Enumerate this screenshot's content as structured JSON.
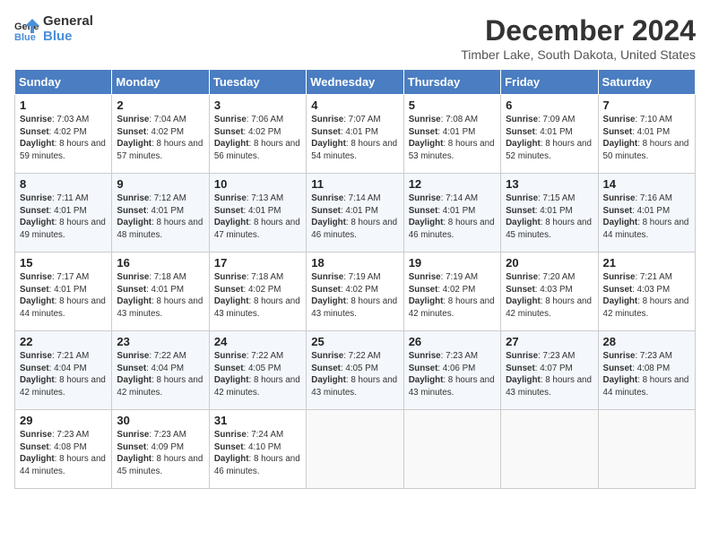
{
  "header": {
    "logo_line1": "General",
    "logo_line2": "Blue",
    "title": "December 2024",
    "subtitle": "Timber Lake, South Dakota, United States"
  },
  "days_of_week": [
    "Sunday",
    "Monday",
    "Tuesday",
    "Wednesday",
    "Thursday",
    "Friday",
    "Saturday"
  ],
  "weeks": [
    [
      {
        "day": "1",
        "info": "Sunrise: 7:03 AM\nSunset: 4:02 PM\nDaylight: 8 hours and 59 minutes."
      },
      {
        "day": "2",
        "info": "Sunrise: 7:04 AM\nSunset: 4:02 PM\nDaylight: 8 hours and 57 minutes."
      },
      {
        "day": "3",
        "info": "Sunrise: 7:06 AM\nSunset: 4:02 PM\nDaylight: 8 hours and 56 minutes."
      },
      {
        "day": "4",
        "info": "Sunrise: 7:07 AM\nSunset: 4:01 PM\nDaylight: 8 hours and 54 minutes."
      },
      {
        "day": "5",
        "info": "Sunrise: 7:08 AM\nSunset: 4:01 PM\nDaylight: 8 hours and 53 minutes."
      },
      {
        "day": "6",
        "info": "Sunrise: 7:09 AM\nSunset: 4:01 PM\nDaylight: 8 hours and 52 minutes."
      },
      {
        "day": "7",
        "info": "Sunrise: 7:10 AM\nSunset: 4:01 PM\nDaylight: 8 hours and 50 minutes."
      }
    ],
    [
      {
        "day": "8",
        "info": "Sunrise: 7:11 AM\nSunset: 4:01 PM\nDaylight: 8 hours and 49 minutes."
      },
      {
        "day": "9",
        "info": "Sunrise: 7:12 AM\nSunset: 4:01 PM\nDaylight: 8 hours and 48 minutes."
      },
      {
        "day": "10",
        "info": "Sunrise: 7:13 AM\nSunset: 4:01 PM\nDaylight: 8 hours and 47 minutes."
      },
      {
        "day": "11",
        "info": "Sunrise: 7:14 AM\nSunset: 4:01 PM\nDaylight: 8 hours and 46 minutes."
      },
      {
        "day": "12",
        "info": "Sunrise: 7:14 AM\nSunset: 4:01 PM\nDaylight: 8 hours and 46 minutes."
      },
      {
        "day": "13",
        "info": "Sunrise: 7:15 AM\nSunset: 4:01 PM\nDaylight: 8 hours and 45 minutes."
      },
      {
        "day": "14",
        "info": "Sunrise: 7:16 AM\nSunset: 4:01 PM\nDaylight: 8 hours and 44 minutes."
      }
    ],
    [
      {
        "day": "15",
        "info": "Sunrise: 7:17 AM\nSunset: 4:01 PM\nDaylight: 8 hours and 44 minutes."
      },
      {
        "day": "16",
        "info": "Sunrise: 7:18 AM\nSunset: 4:01 PM\nDaylight: 8 hours and 43 minutes."
      },
      {
        "day": "17",
        "info": "Sunrise: 7:18 AM\nSunset: 4:02 PM\nDaylight: 8 hours and 43 minutes."
      },
      {
        "day": "18",
        "info": "Sunrise: 7:19 AM\nSunset: 4:02 PM\nDaylight: 8 hours and 43 minutes."
      },
      {
        "day": "19",
        "info": "Sunrise: 7:19 AM\nSunset: 4:02 PM\nDaylight: 8 hours and 42 minutes."
      },
      {
        "day": "20",
        "info": "Sunrise: 7:20 AM\nSunset: 4:03 PM\nDaylight: 8 hours and 42 minutes."
      },
      {
        "day": "21",
        "info": "Sunrise: 7:21 AM\nSunset: 4:03 PM\nDaylight: 8 hours and 42 minutes."
      }
    ],
    [
      {
        "day": "22",
        "info": "Sunrise: 7:21 AM\nSunset: 4:04 PM\nDaylight: 8 hours and 42 minutes."
      },
      {
        "day": "23",
        "info": "Sunrise: 7:22 AM\nSunset: 4:04 PM\nDaylight: 8 hours and 42 minutes."
      },
      {
        "day": "24",
        "info": "Sunrise: 7:22 AM\nSunset: 4:05 PM\nDaylight: 8 hours and 42 minutes."
      },
      {
        "day": "25",
        "info": "Sunrise: 7:22 AM\nSunset: 4:05 PM\nDaylight: 8 hours and 43 minutes."
      },
      {
        "day": "26",
        "info": "Sunrise: 7:23 AM\nSunset: 4:06 PM\nDaylight: 8 hours and 43 minutes."
      },
      {
        "day": "27",
        "info": "Sunrise: 7:23 AM\nSunset: 4:07 PM\nDaylight: 8 hours and 43 minutes."
      },
      {
        "day": "28",
        "info": "Sunrise: 7:23 AM\nSunset: 4:08 PM\nDaylight: 8 hours and 44 minutes."
      }
    ],
    [
      {
        "day": "29",
        "info": "Sunrise: 7:23 AM\nSunset: 4:08 PM\nDaylight: 8 hours and 44 minutes."
      },
      {
        "day": "30",
        "info": "Sunrise: 7:23 AM\nSunset: 4:09 PM\nDaylight: 8 hours and 45 minutes."
      },
      {
        "day": "31",
        "info": "Sunrise: 7:24 AM\nSunset: 4:10 PM\nDaylight: 8 hours and 46 minutes."
      },
      null,
      null,
      null,
      null
    ]
  ]
}
